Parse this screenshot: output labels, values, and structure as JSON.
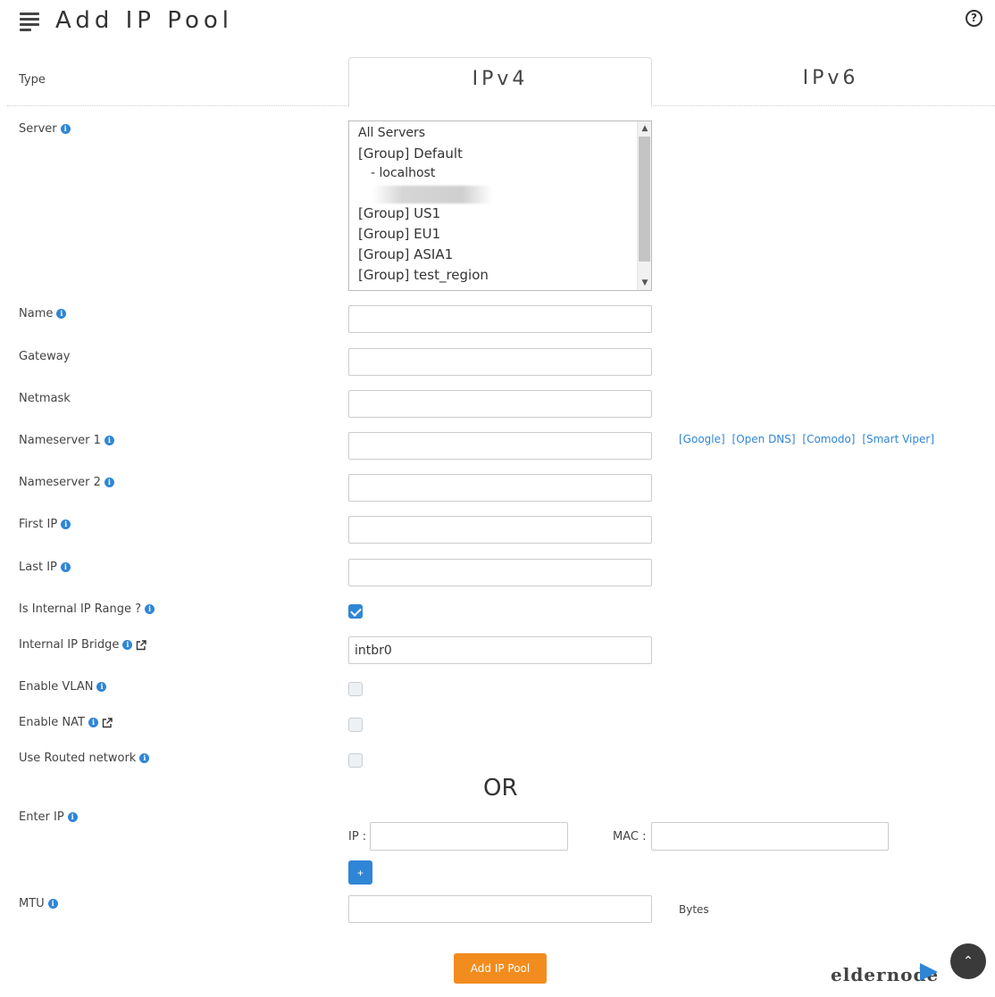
{
  "header": {
    "title": "Add IP Pool",
    "help_icon": "?"
  },
  "tabs": {
    "type_label": "Type",
    "ipv4": "IPv4",
    "ipv6": "IPv6",
    "active": "IPv4"
  },
  "labels": {
    "server": "Server",
    "name": "Name",
    "gateway": "Gateway",
    "netmask": "Netmask",
    "nameserver1": "Nameserver 1",
    "nameserver2": "Nameserver 2",
    "first_ip": "First IP",
    "last_ip": "Last IP",
    "internal_range": "Is Internal IP Range ?",
    "internal_bridge": "Internal IP Bridge",
    "enable_vlan": "Enable VLAN",
    "enable_nat": "Enable NAT",
    "routed_network": "Use Routed network",
    "enter_ip": "Enter IP",
    "mtu": "MTU"
  },
  "server_list": {
    "items": [
      "All Servers",
      "[Group] Default",
      "- localhost",
      "[Group] US1",
      "[Group] EU1",
      "[Group] ASIA1",
      "[Group] test_region"
    ]
  },
  "fields": {
    "name": "",
    "gateway": "",
    "netmask": "",
    "nameserver1": "",
    "nameserver2": "",
    "first_ip": "",
    "last_ip": "",
    "internal_bridge": "intbr0",
    "ip": "",
    "mac": "",
    "mtu": ""
  },
  "checkboxes": {
    "internal_range": true,
    "enable_vlan": false,
    "enable_nat": false,
    "routed_network": false
  },
  "nameserver_presets": [
    "[Google]",
    "[Open DNS]",
    "[Comodo]",
    "[Smart Viper]"
  ],
  "or_text": "OR",
  "enter_ip": {
    "ip_label": "IP :",
    "mac_label": "MAC :",
    "add_button": "+"
  },
  "mtu_unit": "Bytes",
  "submit_label": "Add IP Pool",
  "branding": {
    "logo_text": "eldernode"
  },
  "colors": {
    "accent": "#2f86d6",
    "submit": "#f28c1e"
  }
}
